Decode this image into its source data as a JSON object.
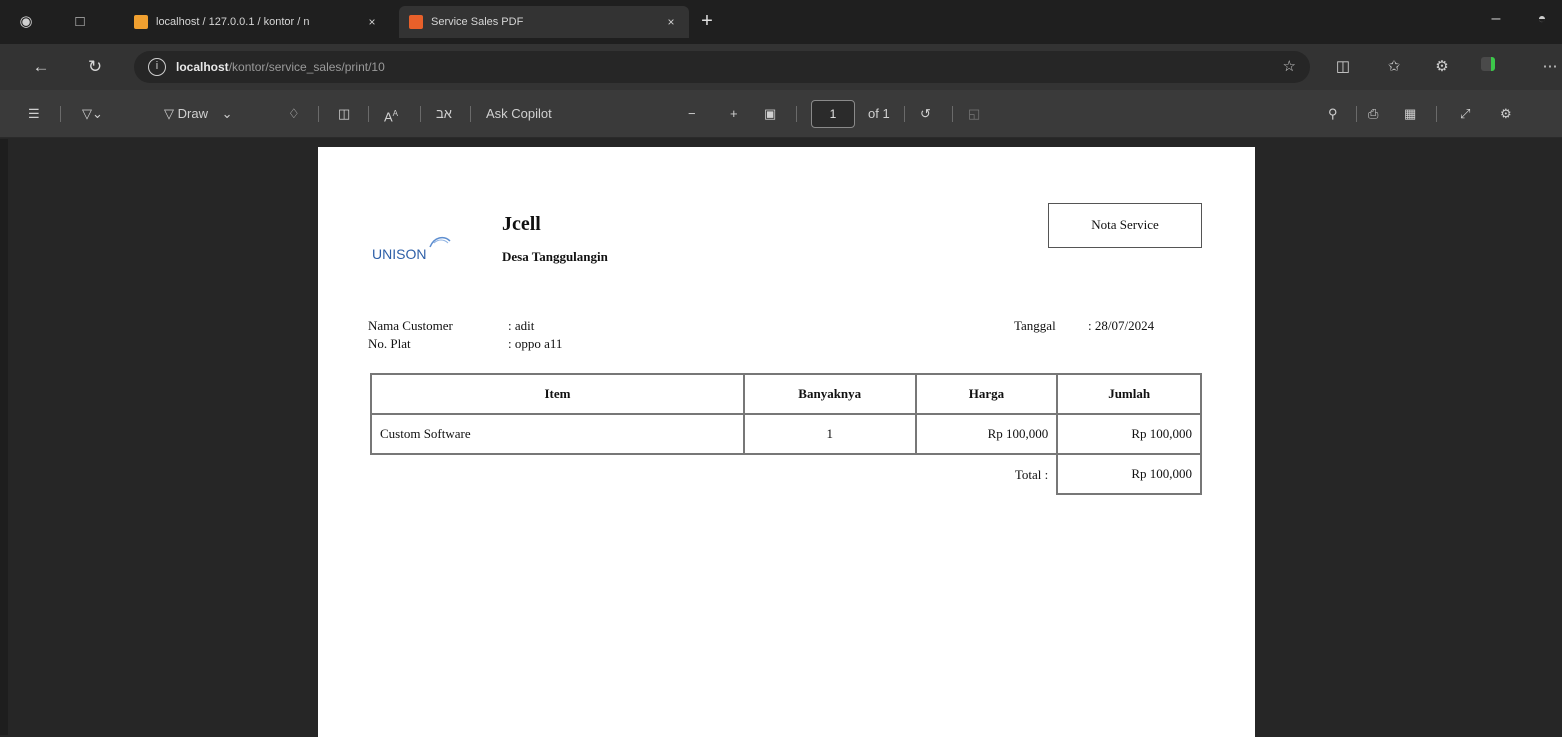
{
  "browser": {
    "tabs": [
      {
        "title": "localhost / 127.0.0.1 / kontor / n",
        "favicon_color": "#f0a030"
      },
      {
        "title": "Service Sales PDF",
        "favicon_color": "#e8602a"
      }
    ],
    "new_tab_symbol": "+",
    "close_symbol": "×",
    "minimize_symbol": "–",
    "address": {
      "host": "localhost",
      "path": "/kontor/service_sales/print/10"
    }
  },
  "pdf_toolbar": {
    "draw_label": "Draw",
    "ask_label": "Ask Copilot",
    "page_current": "1",
    "page_total": "of 1",
    "text_size_label": "A",
    "read_aloud_label": "A"
  },
  "document": {
    "store_name": "Jcell",
    "store_address": "Desa Tanggulangin",
    "logo_text": "UNISON",
    "doc_type": "Nota Service",
    "customer_label": "Nama Customer",
    "customer_value": ": adit",
    "plate_label": "No. Plat",
    "plate_value": ": oppo a11",
    "date_label": "Tanggal",
    "date_value": ": 28/07/2024",
    "table": {
      "headers": [
        "Item",
        "Banyaknya",
        "Harga",
        "Jumlah"
      ],
      "rows": [
        {
          "item": "Custom Software",
          "qty": "1",
          "price": "Rp 100,000",
          "amount": "Rp 100,000"
        }
      ],
      "total_label": "Total :",
      "total_value": "Rp 100,000"
    }
  },
  "colors": {
    "tab_strip": "#1f1f1f",
    "toolbar": "#333333",
    "pdf_toolbar": "#3a3a3a",
    "viewer_bg": "#262626",
    "logo_blue": "#2d5fa8"
  }
}
